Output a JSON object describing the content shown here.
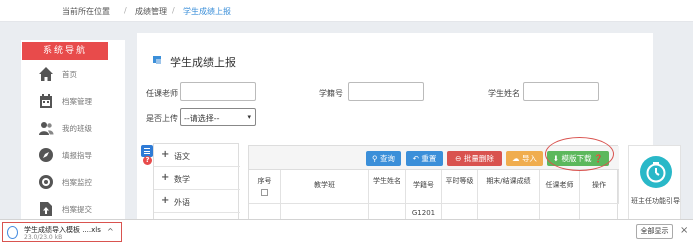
{
  "breadcrumb": {
    "current_location_label": "当前所在位置",
    "separator": "/",
    "level1": "成绩管理",
    "level2": "学生成绩上报"
  },
  "sidebar": {
    "title": "系统导航",
    "items": [
      {
        "label": "首页",
        "icon": "home-icon"
      },
      {
        "label": "档案管理",
        "icon": "calendar-icon"
      },
      {
        "label": "我的班级",
        "icon": "users-icon"
      },
      {
        "label": "填报指导",
        "icon": "compass-icon"
      },
      {
        "label": "档案监控",
        "icon": "eye-icon"
      },
      {
        "label": "档案提交",
        "icon": "file-upload-icon"
      }
    ]
  },
  "main": {
    "page_title": "学生成绩上报",
    "filters": {
      "teacher_label": "任课老师",
      "student_id_label": "学籍号",
      "student_name_label": "学生姓名",
      "teacher_value": "",
      "student_id_value": "",
      "student_name_value": "",
      "uploaded_label": "是否上传",
      "uploaded_selected": "--请选择--"
    },
    "subjects": [
      {
        "label": "语文"
      },
      {
        "label": "数学"
      },
      {
        "label": "外语"
      }
    ],
    "toolbar": {
      "query": "查询",
      "reset": "重置",
      "batch_delete": "批量删除",
      "import": "导入",
      "template_download": "模版下载"
    },
    "table": {
      "headers": [
        "序号",
        "教学班",
        "学生姓名",
        "学籍号",
        "平时等级",
        "期末/结课成绩",
        "任课老师",
        "操作"
      ],
      "rows": [
        {
          "student_id": "G1201"
        }
      ]
    },
    "question_mark": "?"
  },
  "guide": {
    "label": "班主任功能引导"
  },
  "downloads": {
    "file_name": "学生成绩导入模板 ....xls",
    "file_size": "23.0/23.0 kB",
    "show_all": "全部显示",
    "close": "×"
  },
  "colors": {
    "accent_blue": "#3b8fd9",
    "nav_red": "#e84b4b",
    "teal": "#29b8c8",
    "btn_green": "#5cb85c",
    "btn_orange": "#f0ad4e",
    "btn_red": "#d9534f"
  }
}
